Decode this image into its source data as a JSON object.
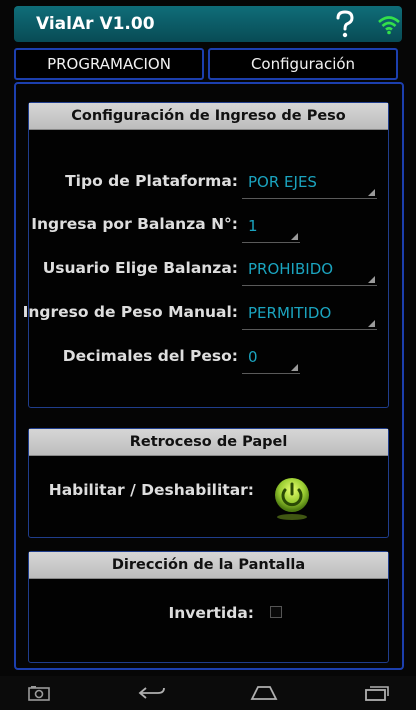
{
  "app": {
    "title": "VialAr V1.00"
  },
  "tabs": [
    {
      "label": "PROGRAMACION"
    },
    {
      "label": "Configuración"
    }
  ],
  "sections": {
    "peso": {
      "title": "Configuración de Ingreso de Peso",
      "rows": [
        {
          "label": "Tipo de Plataforma:",
          "value": "POR EJES"
        },
        {
          "label": "Ingresa por Balanza N°:",
          "value": "1"
        },
        {
          "label": "Usuario Elige Balanza:",
          "value": "PROHIBIDO"
        },
        {
          "label": "Ingreso de Peso Manual:",
          "value": "PERMITIDO"
        },
        {
          "label": "Decimales del Peso:",
          "value": "0"
        }
      ]
    },
    "papel": {
      "title": "Retroceso de Papel",
      "toggle_label": "Habilitar / Deshabilitar:"
    },
    "pantalla": {
      "title": "Dirección de la Pantalla",
      "checkbox_label": "Invertida:"
    }
  },
  "icons": {
    "help": "help-icon",
    "wifi": "wifi-icon",
    "power_toggle": "power-toggle-icon",
    "screenshot": "screenshot-icon",
    "back": "back-icon",
    "home": "home-icon",
    "recents": "recents-icon"
  },
  "colors": {
    "titlebar": "#0f6d79",
    "tab_border": "#1c3fae",
    "value_text": "#1ba4bf",
    "toggle": "#9acd32"
  }
}
